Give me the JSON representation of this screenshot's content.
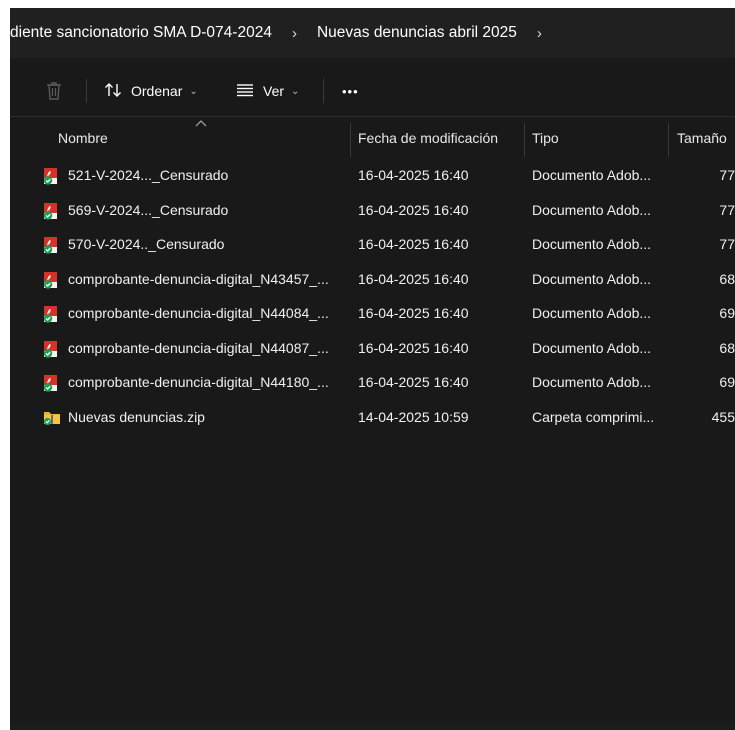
{
  "breadcrumb": {
    "items": [
      "diente sancionatorio SMA D-074-2024",
      "Nuevas denuncias abril 2025"
    ],
    "separator": "›"
  },
  "toolbar": {
    "trash_icon": "trash-icon",
    "sort_label": "Ordenar",
    "view_label": "Ver",
    "more_label": "•••"
  },
  "columns": {
    "name": "Nombre",
    "date": "Fecha de modificación",
    "type": "Tipo",
    "size": "Tamaño"
  },
  "files": [
    {
      "name": "521-V-2024..._Censurado",
      "date": "16-04-2025 16:40",
      "type": "Documento Adob...",
      "size": "77",
      "icon": "pdf-icon"
    },
    {
      "name": "569-V-2024..._Censurado",
      "date": "16-04-2025 16:40",
      "type": "Documento Adob...",
      "size": "77",
      "icon": "pdf-icon"
    },
    {
      "name": "570-V-2024.._Censurado",
      "date": "16-04-2025 16:40",
      "type": "Documento Adob...",
      "size": "77",
      "icon": "pdf-icon"
    },
    {
      "name": "comprobante-denuncia-digital_N43457_...",
      "date": "16-04-2025 16:40",
      "type": "Documento Adob...",
      "size": "68",
      "icon": "pdf-icon"
    },
    {
      "name": "comprobante-denuncia-digital_N44084_...",
      "date": "16-04-2025 16:40",
      "type": "Documento Adob...",
      "size": "69",
      "icon": "pdf-icon"
    },
    {
      "name": "comprobante-denuncia-digital_N44087_...",
      "date": "16-04-2025 16:40",
      "type": "Documento Adob...",
      "size": "68",
      "icon": "pdf-icon"
    },
    {
      "name": "comprobante-denuncia-digital_N44180_...",
      "date": "16-04-2025 16:40",
      "type": "Documento Adob...",
      "size": "69",
      "icon": "pdf-icon"
    },
    {
      "name": "Nuevas denuncias.zip",
      "date": "14-04-2025 10:59",
      "type": "Carpeta comprimi...",
      "size": "455",
      "icon": "zip-folder-icon"
    }
  ],
  "colors": {
    "background": "#191919",
    "addressbar": "#202020",
    "pdf_red": "#d5322a",
    "sync_green": "#1f9d55",
    "folder_yellow": "#f4c542"
  }
}
